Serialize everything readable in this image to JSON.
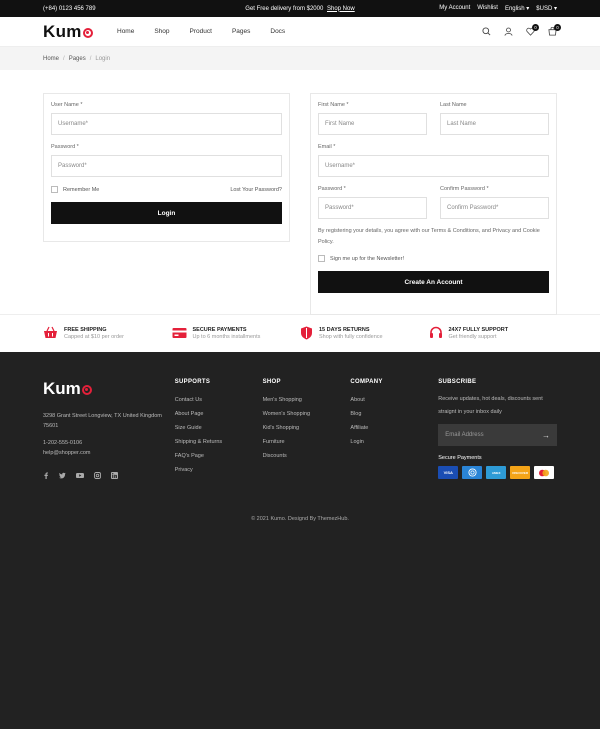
{
  "topbar": {
    "phone": "(+84) 0123 456 789",
    "promo": "Get Free delivery from $2000",
    "promo_link": "Shop Now",
    "my_account": "My Account",
    "wishlist": "Wishlist",
    "language": "English ▾",
    "currency": "$USD ▾"
  },
  "header": {
    "logo": "Kum",
    "nav": [
      "Home",
      "Shop",
      "Product",
      "Pages",
      "Docs"
    ],
    "wishlist_count": "0",
    "cart_count": "0"
  },
  "breadcrumb": [
    "Home",
    "Pages",
    "Login"
  ],
  "login": {
    "username_label": "User Name *",
    "username_placeholder": "Username*",
    "password_label": "Password *",
    "password_placeholder": "Password*",
    "remember": "Remember Me",
    "forgot": "Lost Your Password?",
    "button": "Login"
  },
  "register": {
    "first_label": "First Name *",
    "first_placeholder": "First Name",
    "last_label": "Last Name",
    "last_placeholder": "Last Name",
    "email_label": "Email *",
    "email_placeholder": "Username*",
    "password_label": "Password *",
    "password_placeholder": "Password*",
    "confirm_label": "Confirm Password *",
    "confirm_placeholder": "Confirm Password*",
    "terms": "By registering your details, you agree with our Terms & Conditions, and Privacy and Cookie Policy.",
    "newsletter": "Sign me up for the Newsletter!",
    "button": "Create An Account"
  },
  "features": [
    {
      "title": "FREE SHIPPING",
      "sub": "Capped at $10 per order",
      "icon": "basket-icon"
    },
    {
      "title": "SECURE PAYMENTS",
      "sub": "Up to 6 months installments",
      "icon": "card-icon"
    },
    {
      "title": "15 DAYS RETURNS",
      "sub": "Shop with fully confidence",
      "icon": "shield-icon"
    },
    {
      "title": "24X7 FULLY SUPPORT",
      "sub": "Get friendly support",
      "icon": "headset-icon"
    }
  ],
  "footer": {
    "logo": "Kum",
    "address": "3298 Grant Street Longview, TX United Kingdom 75601",
    "phone": "1-202-555-0106",
    "email": "help@shopper.com",
    "supports_title": "SUPPORTS",
    "supports": [
      "Contact Us",
      "About Page",
      "Size Guide",
      "Shipping & Returns",
      "FAQ's Page",
      "Privacy"
    ],
    "shop_title": "SHOP",
    "shop": [
      "Men's Shopping",
      "Women's Shopping",
      "Kid's Shopping",
      "Furniture",
      "Discounts"
    ],
    "company_title": "COMPANY",
    "company": [
      "About",
      "Blog",
      "Affiliate",
      "Login"
    ],
    "subscribe_title": "SUBSCRIBE",
    "subscribe_text": "Receive updates, hot deals, discounts sent straignt in your inbox daily",
    "email_placeholder": "Email Address",
    "secure_payments": "Secure Payments",
    "payment_cards": [
      "VISA",
      "DINERS",
      "AMERICAN",
      "DISCOVER",
      "MC"
    ],
    "copyright": "© 2021 Kumo. Designd By ThemezHub."
  },
  "colors": {
    "accent": "#e4203a",
    "dark": "#111111",
    "footer_bg": "#222222"
  }
}
